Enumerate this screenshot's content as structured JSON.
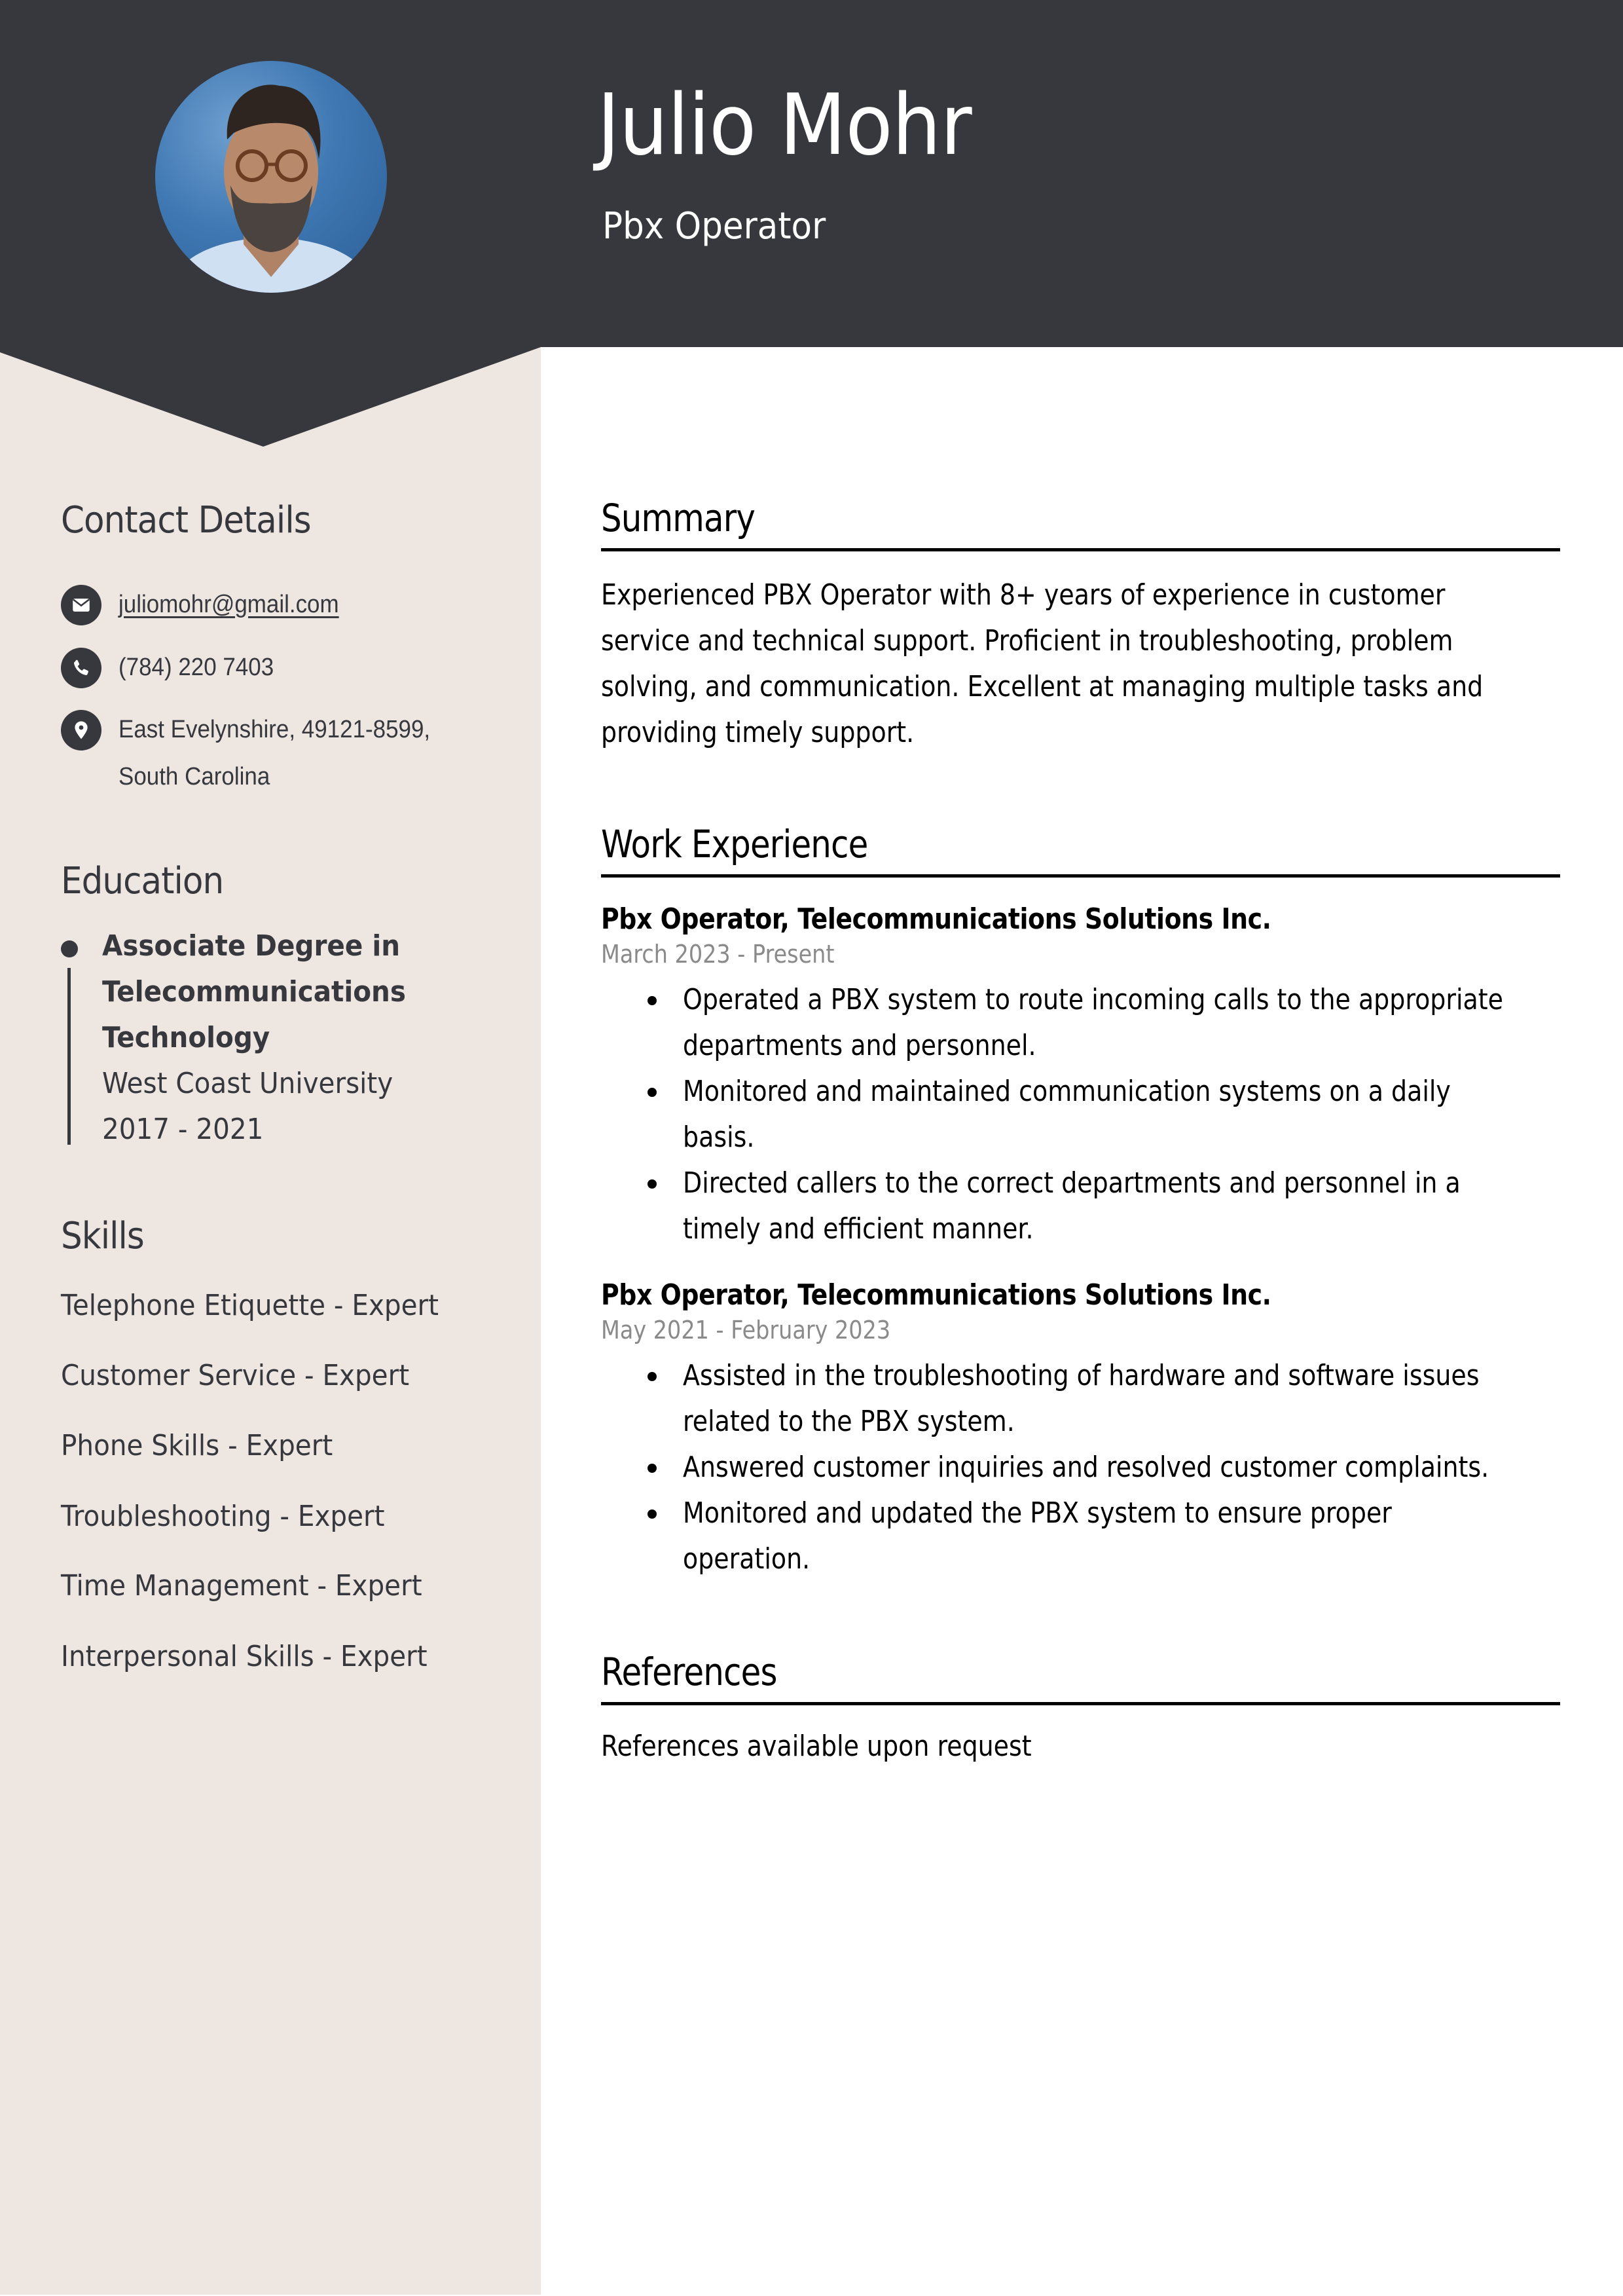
{
  "header": {
    "name": "Julio Mohr",
    "job_title": "Pbx Operator",
    "photo_alt": "profile-photo"
  },
  "colors": {
    "header_bg": "#37383E",
    "sidebar_bg": "#EEE6E1",
    "text_dark": "#37383E",
    "date_gray": "#8a8a8a"
  },
  "sidebar": {
    "contact": {
      "heading": "Contact Details",
      "items": [
        {
          "icon": "envelope-icon",
          "text": "juliomohr@gmail.com"
        },
        {
          "icon": "phone-icon",
          "text": "(784) 220 7403"
        },
        {
          "icon": "map-pin-icon",
          "line1": "East Evelynshire, 49121-8599,",
          "line2": "South Carolina"
        }
      ]
    },
    "education": {
      "heading": "Education",
      "degree_lines": [
        "Associate Degree in",
        "Telecommunications",
        "Technology"
      ],
      "school": "West Coast University",
      "years": "2017 - 2021"
    },
    "skills": {
      "heading": "Skills",
      "items": [
        "Telephone Etiquette - Expert",
        "Customer Service - Expert",
        "Phone Skills - Expert",
        "Troubleshooting - Expert",
        "Time Management - Expert",
        "Interpersonal Skills - Expert"
      ]
    }
  },
  "main": {
    "summary": {
      "heading": "Summary",
      "lines": [
        "Experienced PBX Operator with 8+ years of experience in customer",
        "service and technical support. Proficient in troubleshooting, problem",
        "solving, and communication. Excellent at managing multiple tasks and",
        "providing timely support."
      ]
    },
    "experience": {
      "heading": "Work Experience",
      "jobs": [
        {
          "title": "Pbx Operator, Telecommunications Solutions Inc.",
          "dates": "March 2023 - Present",
          "bullets": [
            [
              "Operated a PBX system to route incoming calls to the appropriate",
              "departments and personnel."
            ],
            [
              "Monitored and maintained communication systems on a daily",
              "basis."
            ],
            [
              "Directed callers to the correct departments and personnel in a",
              "timely and efficient manner."
            ]
          ]
        },
        {
          "title": "Pbx Operator, Telecommunications Solutions Inc.",
          "dates": "May 2021 - February 2023",
          "bullets": [
            [
              "Assisted in the troubleshooting of hardware and software issues",
              "related to the PBX system."
            ],
            [
              "Answered customer inquiries and resolved customer complaints."
            ],
            [
              "Monitored and updated the PBX system to ensure proper",
              "operation."
            ]
          ]
        }
      ]
    },
    "references": {
      "heading": "References",
      "text": "References available upon request"
    }
  }
}
